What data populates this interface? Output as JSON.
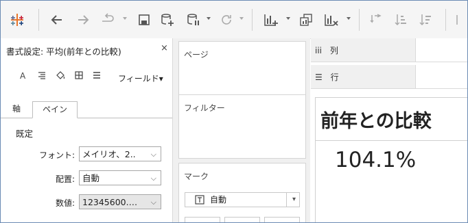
{
  "toolbar": {
    "buttons": [
      {
        "name": "tableau-logo-icon"
      },
      {
        "name": "back-icon"
      },
      {
        "name": "forward-icon"
      },
      {
        "name": "redo-dropdown-icon"
      },
      {
        "name": "save-icon"
      },
      {
        "name": "new-data-source-icon"
      },
      {
        "name": "pause-auto-updates-icon"
      },
      {
        "name": "refresh-icon"
      },
      {
        "name": "new-worksheet-icon"
      },
      {
        "name": "duplicate-sheet-icon"
      },
      {
        "name": "clear-sheet-icon"
      },
      {
        "name": "swap-icon"
      },
      {
        "name": "sort-ascending-icon"
      },
      {
        "name": "sort-descending-icon"
      }
    ]
  },
  "format_panel": {
    "title": "書式設定: 平均(前年との比較)",
    "close": "×",
    "field_menu": "フィールド▾",
    "tabs": [
      "軸",
      "ペイン"
    ],
    "active_tab": "ペイン",
    "section": "既定",
    "rows": [
      {
        "label": "フォント:",
        "value": "メイリオ、2..",
        "grey": false
      },
      {
        "label": "配置:",
        "value": "自動",
        "grey": false
      },
      {
        "label": "数値:",
        "value": "12345600.…",
        "grey": true
      }
    ]
  },
  "shelves": {
    "pages": "ページ",
    "filters": "フィルター",
    "marks": "マーク",
    "mark_type": "自動",
    "columns_icon": "iii",
    "columns": "列",
    "rows_icon": "☰",
    "rows": "行"
  },
  "view": {
    "title": "前年との比較",
    "value": "104.1%"
  }
}
